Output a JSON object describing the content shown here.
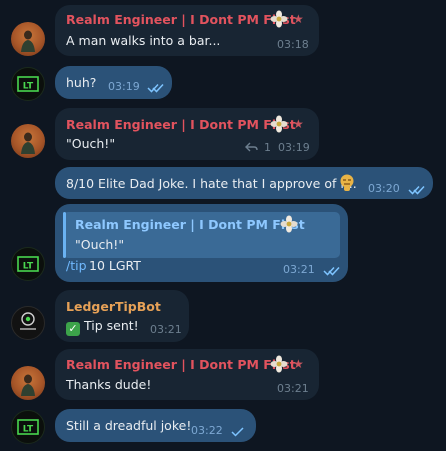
{
  "messages": [
    {
      "sender": "Realm Engineer | I Dont PM First",
      "text": "A man walks into a bar...",
      "time": "03:18"
    },
    {
      "text": "huh?",
      "time": "03:19"
    },
    {
      "sender": "Realm Engineer | I Dont PM First",
      "text": "\"Ouch!\"",
      "replies": "1",
      "time": "03:19"
    },
    {
      "text": "8/10 Elite Dad Joke. I hate that I approve of it..",
      "time": "03:20"
    },
    {
      "reply_sender": "Realm Engineer | I Dont PM First",
      "reply_text": "\"Ouch!\"",
      "command": "/tip",
      "amount": "10 LGRT",
      "time": "03:21"
    },
    {
      "sender": "LedgerTipBot",
      "text": "Tip sent!",
      "time": "03:21"
    },
    {
      "sender": "Realm Engineer | I Dont PM First",
      "text": "Thanks dude!",
      "time": "03:21"
    },
    {
      "text": "Still a dreadful joke!",
      "time": "03:22"
    }
  ],
  "avatars": {
    "lt_label": "LT"
  },
  "colors": {
    "background": "#0e1621",
    "incoming": "#182533",
    "outgoing": "#2b5278",
    "sender": "#e2535e",
    "bot_sender": "#e6a157",
    "link": "#71baff"
  },
  "icons": [
    "star-icon",
    "reply-arrow-icon",
    "double-check-icon",
    "single-check-icon",
    "check-emoji-icon"
  ]
}
